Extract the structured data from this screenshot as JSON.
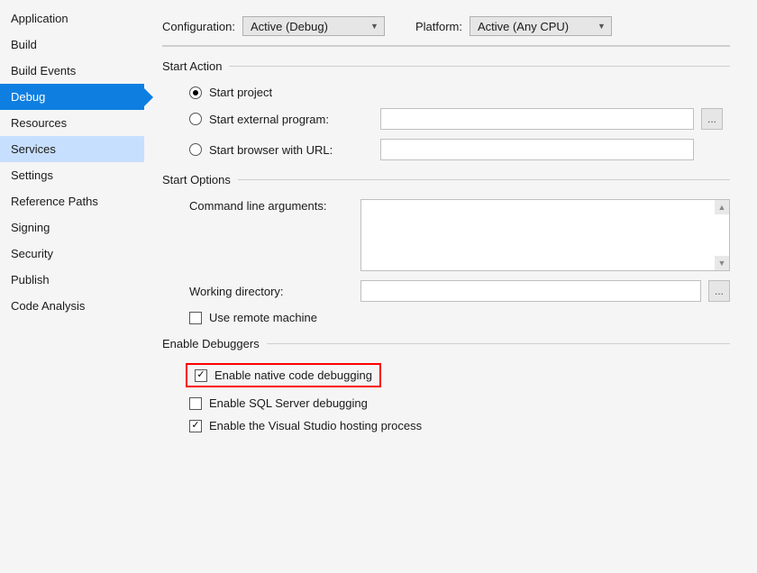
{
  "sidebar": {
    "items": [
      {
        "label": "Application"
      },
      {
        "label": "Build"
      },
      {
        "label": "Build Events"
      },
      {
        "label": "Debug"
      },
      {
        "label": "Resources"
      },
      {
        "label": "Services"
      },
      {
        "label": "Settings"
      },
      {
        "label": "Reference Paths"
      },
      {
        "label": "Signing"
      },
      {
        "label": "Security"
      },
      {
        "label": "Publish"
      },
      {
        "label": "Code Analysis"
      }
    ]
  },
  "top": {
    "configuration_label": "Configuration:",
    "configuration_value": "Active (Debug)",
    "platform_label": "Platform:",
    "platform_value": "Active (Any CPU)"
  },
  "sections": {
    "start_action": {
      "title": "Start Action",
      "start_project": "Start project",
      "start_external": "Start external program:",
      "start_browser": "Start browser with URL:"
    },
    "start_options": {
      "title": "Start Options",
      "cmd_args": "Command line arguments:",
      "working_dir": "Working directory:",
      "use_remote": "Use remote machine"
    },
    "enable_debuggers": {
      "title": "Enable Debuggers",
      "native": "Enable native code debugging",
      "sql": "Enable SQL Server debugging",
      "hosting": "Enable the Visual Studio hosting process"
    }
  }
}
